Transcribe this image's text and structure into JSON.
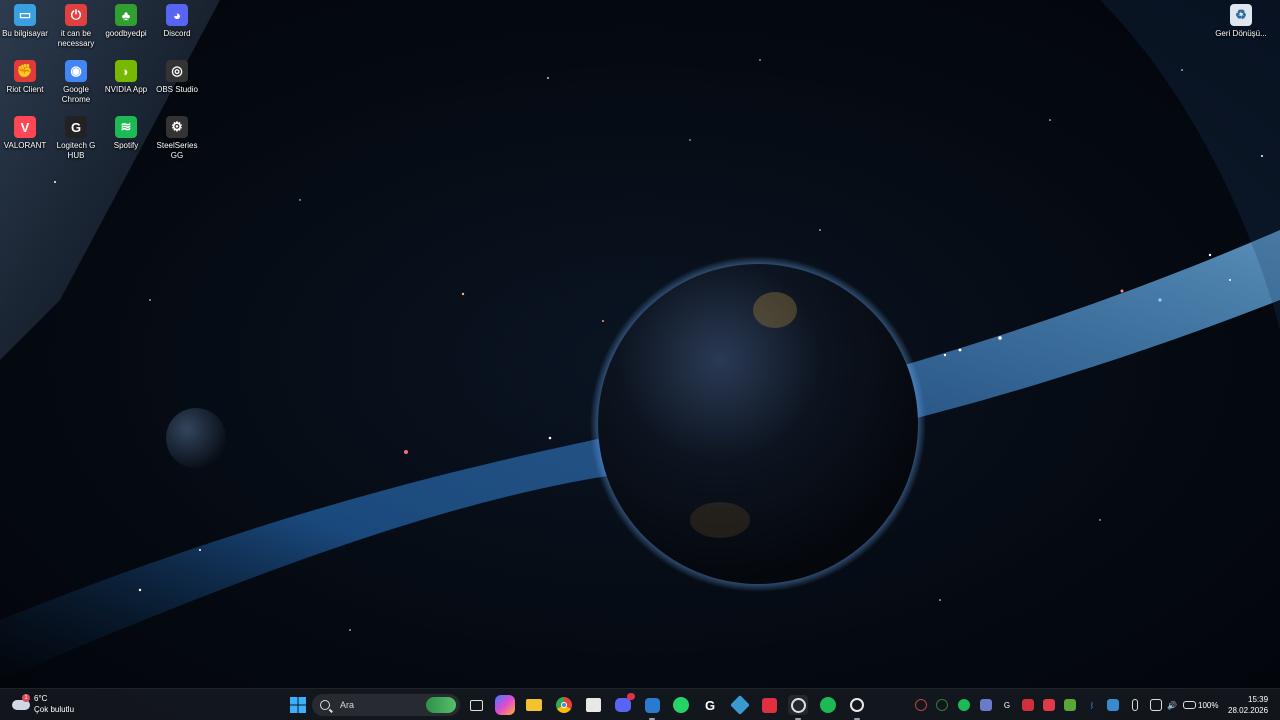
{
  "desktop": {
    "icons": [
      {
        "label": "Bu bilgisayar",
        "icon": "computer-icon",
        "color": "#3aa0e0"
      },
      {
        "label": "it can be necessary",
        "icon": "power-icon",
        "color": "#e04040"
      },
      {
        "label": "goodbyedpi",
        "icon": "tree-icon",
        "color": "#2fa02f"
      },
      {
        "label": "Discord",
        "icon": "discord-icon",
        "color": "#5865f2"
      },
      {
        "label": "Riot Client",
        "icon": "riot-icon",
        "color": "#e03a3a"
      },
      {
        "label": "Google Chrome",
        "icon": "chrome-icon",
        "color": "#4285f4"
      },
      {
        "label": "NVIDIA App",
        "icon": "nvidia-icon",
        "color": "#76b900"
      },
      {
        "label": "OBS Studio",
        "icon": "obs-icon",
        "color": "#333333"
      },
      {
        "label": "VALORANT",
        "icon": "valorant-icon",
        "color": "#ff4655"
      },
      {
        "label": "Logitech G HUB",
        "icon": "logitech-icon",
        "color": "#222222"
      },
      {
        "label": "Spotify",
        "icon": "spotify-icon",
        "color": "#1db954"
      },
      {
        "label": "SteelSeries GG",
        "icon": "steelseries-icon",
        "color": "#333333"
      },
      {
        "label": "Geri Dönüşü...",
        "icon": "recycle-bin-icon",
        "color": "#dfe6ee"
      }
    ]
  },
  "taskbar": {
    "weather": {
      "temp": "6°C",
      "desc": "Çok bulutlu",
      "badge": "1"
    },
    "search_placeholder": "Ara",
    "tray": {
      "battery": "100%",
      "time": "15:39",
      "date": "28.02.2026"
    }
  }
}
